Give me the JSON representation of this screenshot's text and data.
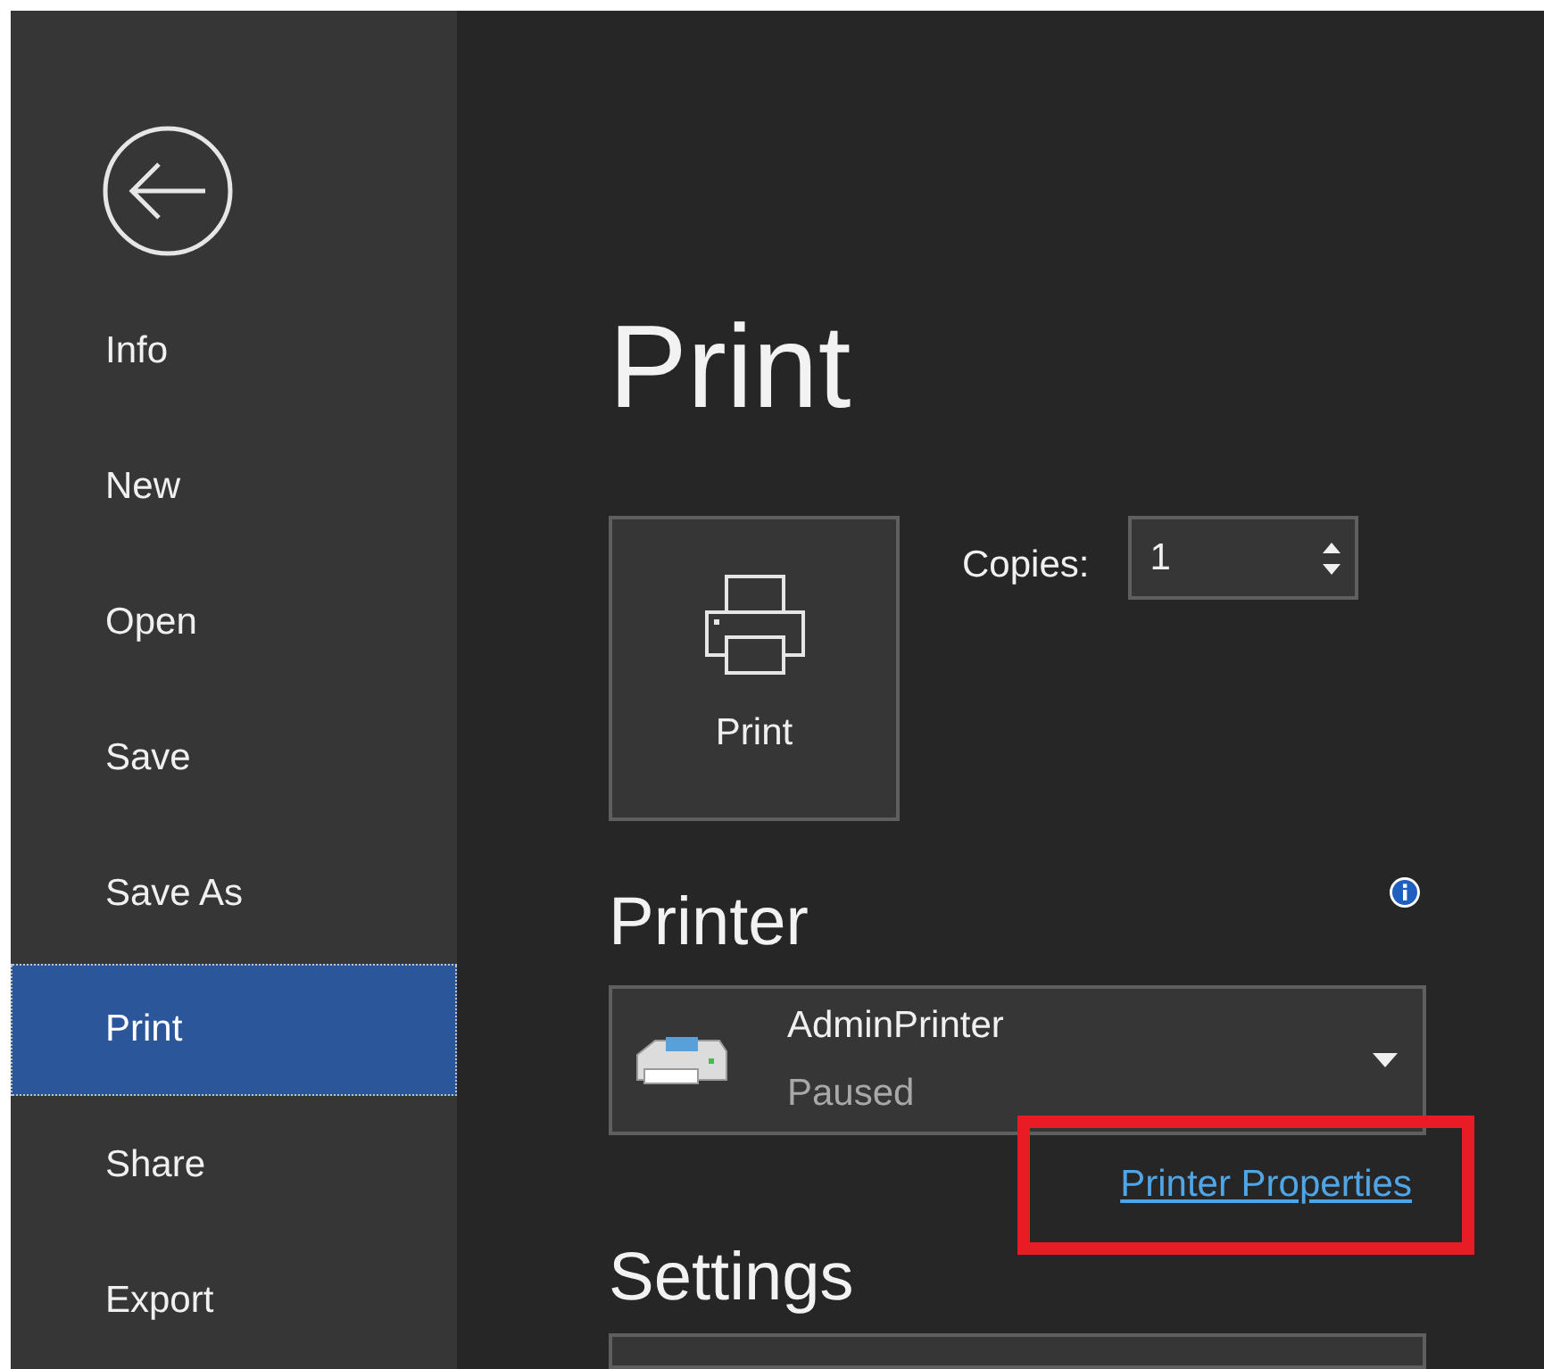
{
  "sidebar": {
    "items": [
      {
        "label": "Info",
        "selected": false
      },
      {
        "label": "New",
        "selected": false
      },
      {
        "label": "Open",
        "selected": false
      },
      {
        "label": "Save",
        "selected": false
      },
      {
        "label": "Save As",
        "selected": false
      },
      {
        "label": "Print",
        "selected": true
      },
      {
        "label": "Share",
        "selected": false
      },
      {
        "label": "Export",
        "selected": false
      }
    ]
  },
  "page_title": "Print",
  "print_button": {
    "label": "Print"
  },
  "copies": {
    "label": "Copies:",
    "value": "1"
  },
  "printer": {
    "heading": "Printer",
    "name": "AdminPrinter",
    "status": "Paused",
    "properties_link": "Printer Properties"
  },
  "settings": {
    "heading": "Settings"
  }
}
